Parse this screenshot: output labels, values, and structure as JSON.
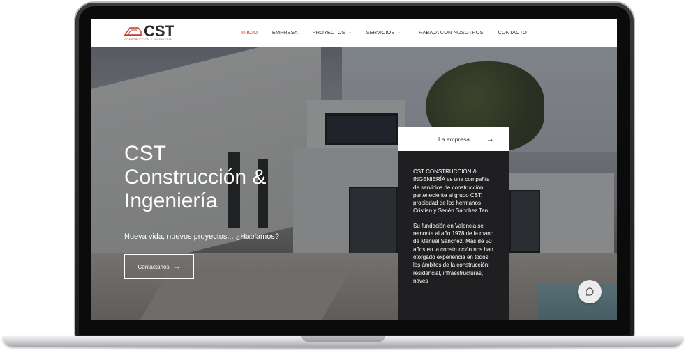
{
  "nav": {
    "logo_text": "CST",
    "logo_sub": "CONSTRUCCIÓN & INGENIERÍA",
    "items": [
      {
        "label": "INICIO",
        "active": true,
        "dropdown": false
      },
      {
        "label": "EMPRESA",
        "active": false,
        "dropdown": false
      },
      {
        "label": "PROYECTOS",
        "active": false,
        "dropdown": true
      },
      {
        "label": "SERVICIOS",
        "active": false,
        "dropdown": true
      },
      {
        "label": "TRABAJA CON NOSOTROS",
        "active": false,
        "dropdown": false
      },
      {
        "label": "CONTACTO",
        "active": false,
        "dropdown": false
      }
    ]
  },
  "hero": {
    "title_line1": "CST",
    "title_line2": "Construcción &",
    "title_line3": "Ingeniería",
    "subtitle": "Nueva vida, nuevos proyectos... ¿Hablamos?",
    "cta_label": "Contáctanos",
    "cta_arrow": "→"
  },
  "panel": {
    "header_label": "La empresa",
    "header_arrow": "→",
    "paragraph1": "CST CONSTRUCCIÓN & INGENIERÍA  es una compañía de servicios de construcción perteneciente al grupo CST, propiedad de los hermanos Cristian y Senén Sánchez Ten.",
    "paragraph2": "Su fundación en Valencia se remonta al año 1978 de la mano de Manuel Sánchez. Más de 50 años en la construcción nos han otorgado experiencia en todos los ámbitos de la construcción: residencial, infraestructuras, naves"
  },
  "colors": {
    "accent": "#d0302d",
    "panel_bg": "#1f1f21",
    "nav_text": "#333333"
  },
  "icons": {
    "chat": "chat-bubble-icon",
    "logo": "truck-logo-icon"
  }
}
